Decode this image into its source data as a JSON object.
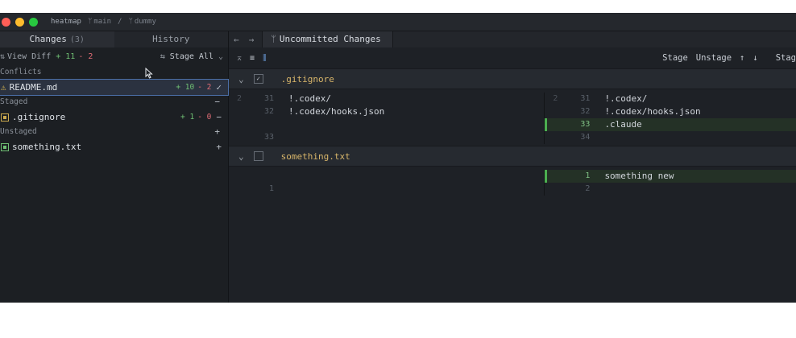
{
  "titlebar": {
    "repo": "heatmap",
    "branch_icon": "branch-icon",
    "branch": "main",
    "sep": "/",
    "worktree": "dummy",
    "traffic_colors": [
      "#ff5f57",
      "#febc2e",
      "#28c840"
    ]
  },
  "left": {
    "tabs": [
      {
        "label": "Changes",
        "count": "(3)"
      },
      {
        "label": "History"
      }
    ],
    "toolbar": {
      "view_diff": "View Diff",
      "additions": "+ 11",
      "deletions": "- 2",
      "stage_all": "Stage All"
    },
    "sections": {
      "conflicts": "Conflicts",
      "staged": "Staged",
      "unstaged": "Unstaged",
      "staged_action": "−",
      "unstaged_action": "+"
    },
    "files": {
      "readme": {
        "name": "README.md",
        "add": "+ 10",
        "del": "- 2",
        "tail": "✓"
      },
      "gitignore": {
        "name": ".gitignore",
        "add": "+ 1",
        "del": "- 0",
        "tail": "−"
      },
      "something": {
        "name": "something.txt",
        "tail": "+"
      }
    }
  },
  "right": {
    "tab_title": "Uncommitted Changes",
    "toolbar": {
      "stage": "Stage",
      "unstage": "Unstage",
      "up": "↑",
      "down": "↓",
      "stage_cut": "Stag"
    },
    "diff1": {
      "file": ".gitignore",
      "left": [
        {
          "a": "2",
          "n": "31",
          "text": "!.codex/"
        },
        {
          "a": "",
          "n": "32",
          "text": "!.codex/hooks.json"
        },
        {
          "a": "",
          "n": "",
          "text": ""
        },
        {
          "a": "",
          "n": "33",
          "text": ""
        }
      ],
      "right": [
        {
          "a": "2",
          "n": "31",
          "text": "!.codex/"
        },
        {
          "a": "",
          "n": "32",
          "text": "!.codex/hooks.json"
        },
        {
          "a": "",
          "n": "33",
          "text": ".claude"
        },
        {
          "a": "",
          "n": "34",
          "text": ""
        }
      ]
    },
    "diff2": {
      "file": "something.txt",
      "left": [
        {
          "n": "",
          "text": ""
        },
        {
          "n": "1",
          "text": ""
        }
      ],
      "right": [
        {
          "n": "1",
          "text": "something new"
        },
        {
          "n": "2",
          "text": ""
        }
      ]
    }
  }
}
